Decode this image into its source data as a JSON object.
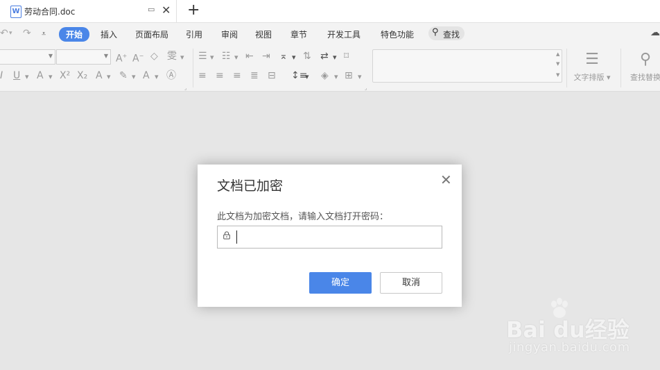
{
  "tab": {
    "icon_letter": "W",
    "title": "劳动合同.doc",
    "new_tab": "+"
  },
  "menu": {
    "items": [
      "开始",
      "插入",
      "页面布局",
      "引用",
      "审阅",
      "视图",
      "章节",
      "开发工具",
      "特色功能"
    ],
    "active": "开始",
    "search_label": "查找"
  },
  "ribbon": {
    "text_layout_label": "文字排版",
    "find_replace_label": "查找替换"
  },
  "dialog": {
    "title": "文档已加密",
    "prompt": "此文档为加密文档，请输入文档打开密码：",
    "password_value": "",
    "ok_label": "确定",
    "cancel_label": "取消"
  },
  "watermark": {
    "logo_text": "Bai  du经验",
    "url_text": "jingyan.baidu.com"
  },
  "colors": {
    "accent": "#4a86e8",
    "background": "#e6e6e6",
    "ribbon": "#f3f3f3"
  }
}
